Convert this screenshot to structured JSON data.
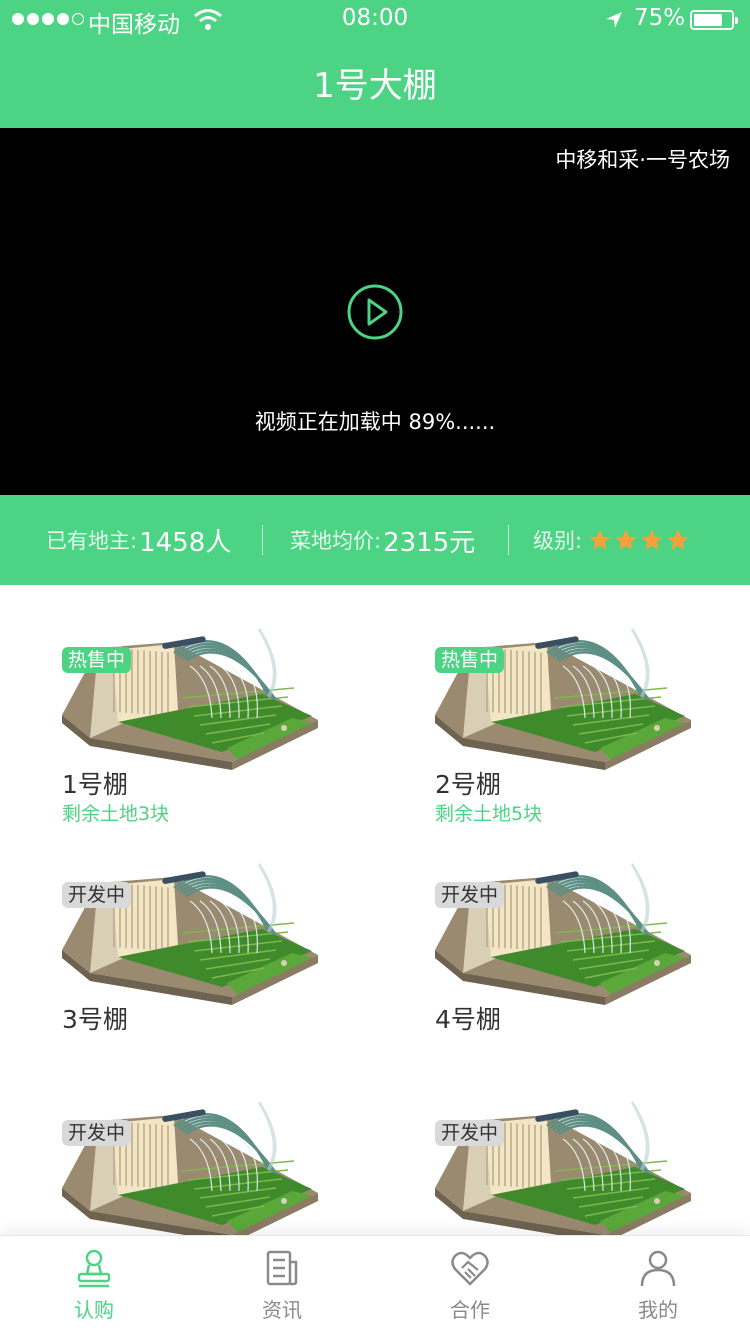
{
  "status": {
    "carrier": "中国移动",
    "time": "08:00",
    "battery": "75%"
  },
  "nav": {
    "title": "1号大棚"
  },
  "video": {
    "farm_name": "中移和采·一号农场",
    "loading_text": "视频正在加载中 89%......"
  },
  "info": {
    "landlords_label": "已有地主:",
    "landlords_value": "1458人",
    "price_label": "菜地均价:",
    "price_value": "2315元",
    "level_label": "级别:",
    "level_stars": 4
  },
  "greenhouses": [
    {
      "badge": "热售中",
      "status": "hot",
      "name": "1号棚",
      "remaining": "剩余土地3块"
    },
    {
      "badge": "热售中",
      "status": "hot",
      "name": "2号棚",
      "remaining": "剩余土地5块"
    },
    {
      "badge": "开发中",
      "status": "dev",
      "name": "3号棚",
      "remaining": ""
    },
    {
      "badge": "开发中",
      "status": "dev",
      "name": "4号棚",
      "remaining": ""
    },
    {
      "badge": "开发中",
      "status": "dev",
      "name": "",
      "remaining": ""
    },
    {
      "badge": "开发中",
      "status": "dev",
      "name": "",
      "remaining": ""
    }
  ],
  "tabs": [
    {
      "label": "认购",
      "icon": "stamp-icon",
      "active": true
    },
    {
      "label": "资讯",
      "icon": "news-icon",
      "active": false
    },
    {
      "label": "合作",
      "icon": "handshake-icon",
      "active": false
    },
    {
      "label": "我的",
      "icon": "user-icon",
      "active": false
    }
  ],
  "colors": {
    "brand_green": "#4cd384",
    "star_orange": "#f7a13a",
    "badge_gray": "#d9d9d9"
  }
}
